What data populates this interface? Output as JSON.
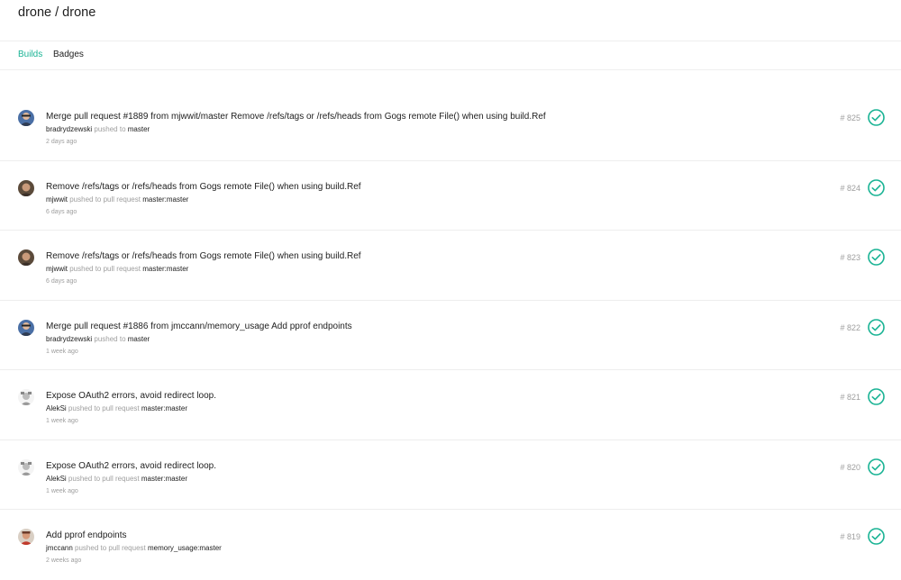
{
  "header": {
    "repo": "drone / drone"
  },
  "tabs": [
    {
      "label": "Builds",
      "active": true
    },
    {
      "label": "Badges",
      "active": false
    }
  ],
  "colors": {
    "accent": "#19b394",
    "success": "#19b394",
    "muted": "#9e9e9e"
  },
  "builds": [
    {
      "message": "Merge pull request #1889 from mjwwit/master Remove /refs/tags or /refs/heads from Gogs remote File() when using build.Ref",
      "author": "bradrydzewski",
      "action": "pushed to",
      "ref": "master",
      "time": "2 days ago",
      "number": "# 825",
      "status": "success",
      "avatar_icon": "avatar-bradrydzewski-icon"
    },
    {
      "message": "Remove /refs/tags or /refs/heads from Gogs remote File() when using build.Ref",
      "author": "mjwwit",
      "action": "pushed to pull request",
      "ref": "master:master",
      "time": "6 days ago",
      "number": "# 824",
      "status": "success",
      "avatar_icon": "avatar-mjwwit-icon"
    },
    {
      "message": "Remove /refs/tags or /refs/heads from Gogs remote File() when using build.Ref",
      "author": "mjwwit",
      "action": "pushed to pull request",
      "ref": "master:master",
      "time": "6 days ago",
      "number": "# 823",
      "status": "success",
      "avatar_icon": "avatar-mjwwit-icon"
    },
    {
      "message": "Merge pull request #1886 from jmccann/memory_usage Add pprof endpoints",
      "author": "bradrydzewski",
      "action": "pushed to",
      "ref": "master",
      "time": "1 week ago",
      "number": "# 822",
      "status": "success",
      "avatar_icon": "avatar-bradrydzewski-icon"
    },
    {
      "message": "Expose OAuth2 errors, avoid redirect loop.",
      "author": "AlekSi",
      "action": "pushed to pull request",
      "ref": "master:master",
      "time": "1 week ago",
      "number": "# 821",
      "status": "success",
      "avatar_icon": "avatar-aleksi-icon"
    },
    {
      "message": "Expose OAuth2 errors, avoid redirect loop.",
      "author": "AlekSi",
      "action": "pushed to pull request",
      "ref": "master:master",
      "time": "1 week ago",
      "number": "# 820",
      "status": "success",
      "avatar_icon": "avatar-aleksi-icon"
    },
    {
      "message": "Add pprof endpoints",
      "author": "jmccann",
      "action": "pushed to pull request",
      "ref": "memory_usage:master",
      "time": "2 weeks ago",
      "number": "# 819",
      "status": "success",
      "avatar_icon": "avatar-jmccann-icon"
    }
  ]
}
